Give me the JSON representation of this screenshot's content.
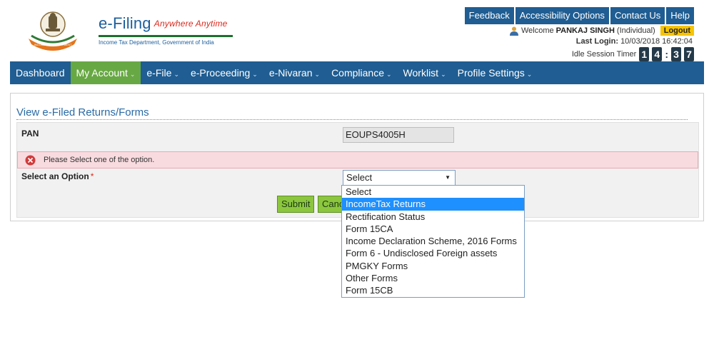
{
  "header": {
    "brand_title": "e-Filing",
    "brand_tagline": "Anywhere Anytime",
    "brand_subtitle": "Income Tax Department, Government of India",
    "emblem_text": "INCOME TAX DEPARTMENT",
    "top_links": [
      "Feedback",
      "Accessibility Options",
      "Contact Us",
      "Help"
    ],
    "welcome_prefix": "Welcome",
    "user_name": "PANKAJ SINGH",
    "user_type": "(Individual)",
    "logout_label": "Logout",
    "last_login_label": "Last Login:",
    "last_login_value": "10/03/2018 16:42:04",
    "idle_label": "Idle Session Timer",
    "timer_digits": [
      "1",
      "4",
      "3",
      "7"
    ]
  },
  "nav": {
    "items": [
      {
        "label": "Dashboard",
        "caret": false
      },
      {
        "label": "My Account",
        "caret": true,
        "active": true
      },
      {
        "label": "e-File",
        "caret": true
      },
      {
        "label": "e-Proceeding",
        "caret": true
      },
      {
        "label": "e-Nivaran",
        "caret": true
      },
      {
        "label": "Compliance",
        "caret": true
      },
      {
        "label": "Worklist",
        "caret": true
      },
      {
        "label": "Profile Settings",
        "caret": true
      }
    ]
  },
  "panel": {
    "title": "View e-Filed Returns/Forms",
    "pan_label": "PAN",
    "pan_value": "EOUPS4005H",
    "error_message": "Please Select one of the option.",
    "option_label": "Select an Option",
    "required_mark": "*",
    "select_value": "Select",
    "submit_label": "Submit",
    "cancel_label": "Cancel"
  },
  "dropdown": {
    "options": [
      "Select",
      "IncomeTax Returns",
      "Rectification Status",
      "Form 15CA",
      "Income Declaration Scheme, 2016 Forms",
      "Form 6 - Undisclosed Foreign assets",
      "PMGKY Forms",
      "Other Forms",
      "Form 15CB"
    ],
    "highlighted_index": 1
  },
  "colors": {
    "nav_bg": "#1f5d92",
    "nav_active": "#68a844",
    "logout_bg": "#f6c400",
    "error_bg": "#f8dbdf",
    "button_bg": "#8cc63f",
    "highlight_bg": "#1e90ff"
  }
}
